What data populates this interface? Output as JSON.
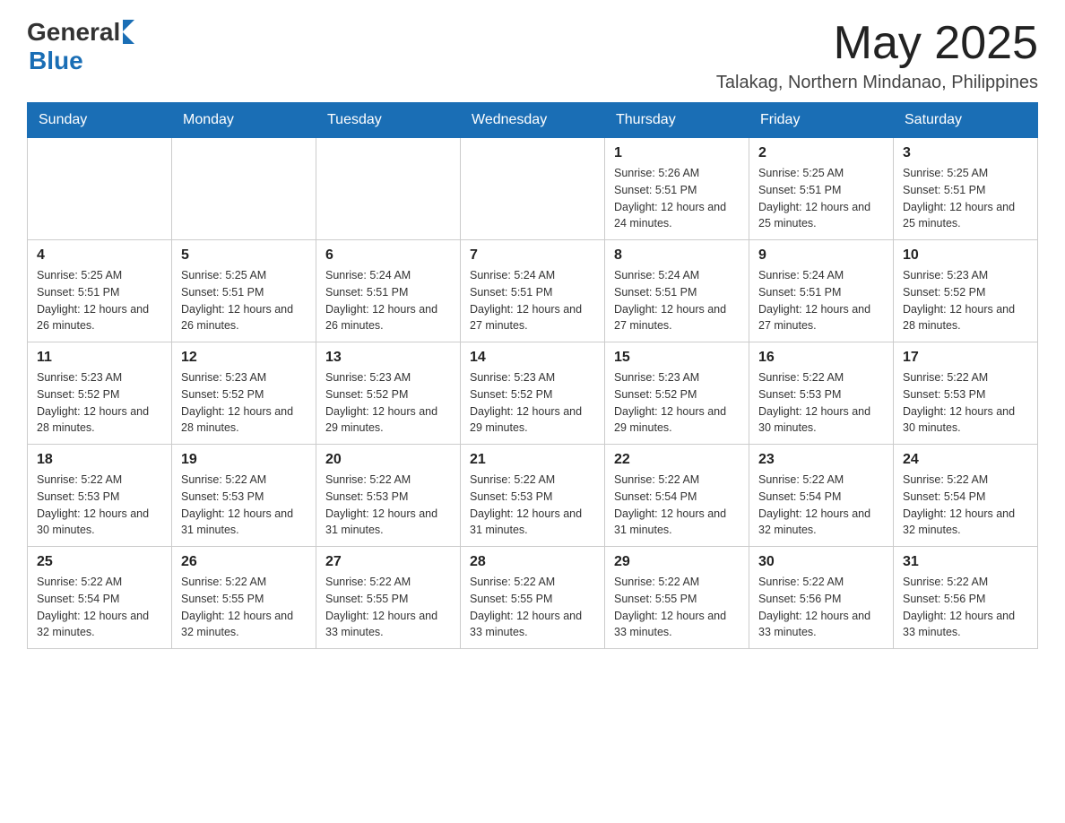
{
  "header": {
    "logo": {
      "general": "General",
      "blue": "Blue"
    },
    "month": "May 2025",
    "location": "Talakag, Northern Mindanao, Philippines"
  },
  "days_of_week": [
    "Sunday",
    "Monday",
    "Tuesday",
    "Wednesday",
    "Thursday",
    "Friday",
    "Saturday"
  ],
  "weeks": [
    [
      {
        "day": "",
        "info": ""
      },
      {
        "day": "",
        "info": ""
      },
      {
        "day": "",
        "info": ""
      },
      {
        "day": "",
        "info": ""
      },
      {
        "day": "1",
        "info": "Sunrise: 5:26 AM\nSunset: 5:51 PM\nDaylight: 12 hours and 24 minutes."
      },
      {
        "day": "2",
        "info": "Sunrise: 5:25 AM\nSunset: 5:51 PM\nDaylight: 12 hours and 25 minutes."
      },
      {
        "day": "3",
        "info": "Sunrise: 5:25 AM\nSunset: 5:51 PM\nDaylight: 12 hours and 25 minutes."
      }
    ],
    [
      {
        "day": "4",
        "info": "Sunrise: 5:25 AM\nSunset: 5:51 PM\nDaylight: 12 hours and 26 minutes."
      },
      {
        "day": "5",
        "info": "Sunrise: 5:25 AM\nSunset: 5:51 PM\nDaylight: 12 hours and 26 minutes."
      },
      {
        "day": "6",
        "info": "Sunrise: 5:24 AM\nSunset: 5:51 PM\nDaylight: 12 hours and 26 minutes."
      },
      {
        "day": "7",
        "info": "Sunrise: 5:24 AM\nSunset: 5:51 PM\nDaylight: 12 hours and 27 minutes."
      },
      {
        "day": "8",
        "info": "Sunrise: 5:24 AM\nSunset: 5:51 PM\nDaylight: 12 hours and 27 minutes."
      },
      {
        "day": "9",
        "info": "Sunrise: 5:24 AM\nSunset: 5:51 PM\nDaylight: 12 hours and 27 minutes."
      },
      {
        "day": "10",
        "info": "Sunrise: 5:23 AM\nSunset: 5:52 PM\nDaylight: 12 hours and 28 minutes."
      }
    ],
    [
      {
        "day": "11",
        "info": "Sunrise: 5:23 AM\nSunset: 5:52 PM\nDaylight: 12 hours and 28 minutes."
      },
      {
        "day": "12",
        "info": "Sunrise: 5:23 AM\nSunset: 5:52 PM\nDaylight: 12 hours and 28 minutes."
      },
      {
        "day": "13",
        "info": "Sunrise: 5:23 AM\nSunset: 5:52 PM\nDaylight: 12 hours and 29 minutes."
      },
      {
        "day": "14",
        "info": "Sunrise: 5:23 AM\nSunset: 5:52 PM\nDaylight: 12 hours and 29 minutes."
      },
      {
        "day": "15",
        "info": "Sunrise: 5:23 AM\nSunset: 5:52 PM\nDaylight: 12 hours and 29 minutes."
      },
      {
        "day": "16",
        "info": "Sunrise: 5:22 AM\nSunset: 5:53 PM\nDaylight: 12 hours and 30 minutes."
      },
      {
        "day": "17",
        "info": "Sunrise: 5:22 AM\nSunset: 5:53 PM\nDaylight: 12 hours and 30 minutes."
      }
    ],
    [
      {
        "day": "18",
        "info": "Sunrise: 5:22 AM\nSunset: 5:53 PM\nDaylight: 12 hours and 30 minutes."
      },
      {
        "day": "19",
        "info": "Sunrise: 5:22 AM\nSunset: 5:53 PM\nDaylight: 12 hours and 31 minutes."
      },
      {
        "day": "20",
        "info": "Sunrise: 5:22 AM\nSunset: 5:53 PM\nDaylight: 12 hours and 31 minutes."
      },
      {
        "day": "21",
        "info": "Sunrise: 5:22 AM\nSunset: 5:53 PM\nDaylight: 12 hours and 31 minutes."
      },
      {
        "day": "22",
        "info": "Sunrise: 5:22 AM\nSunset: 5:54 PM\nDaylight: 12 hours and 31 minutes."
      },
      {
        "day": "23",
        "info": "Sunrise: 5:22 AM\nSunset: 5:54 PM\nDaylight: 12 hours and 32 minutes."
      },
      {
        "day": "24",
        "info": "Sunrise: 5:22 AM\nSunset: 5:54 PM\nDaylight: 12 hours and 32 minutes."
      }
    ],
    [
      {
        "day": "25",
        "info": "Sunrise: 5:22 AM\nSunset: 5:54 PM\nDaylight: 12 hours and 32 minutes."
      },
      {
        "day": "26",
        "info": "Sunrise: 5:22 AM\nSunset: 5:55 PM\nDaylight: 12 hours and 32 minutes."
      },
      {
        "day": "27",
        "info": "Sunrise: 5:22 AM\nSunset: 5:55 PM\nDaylight: 12 hours and 33 minutes."
      },
      {
        "day": "28",
        "info": "Sunrise: 5:22 AM\nSunset: 5:55 PM\nDaylight: 12 hours and 33 minutes."
      },
      {
        "day": "29",
        "info": "Sunrise: 5:22 AM\nSunset: 5:55 PM\nDaylight: 12 hours and 33 minutes."
      },
      {
        "day": "30",
        "info": "Sunrise: 5:22 AM\nSunset: 5:56 PM\nDaylight: 12 hours and 33 minutes."
      },
      {
        "day": "31",
        "info": "Sunrise: 5:22 AM\nSunset: 5:56 PM\nDaylight: 12 hours and 33 minutes."
      }
    ]
  ]
}
